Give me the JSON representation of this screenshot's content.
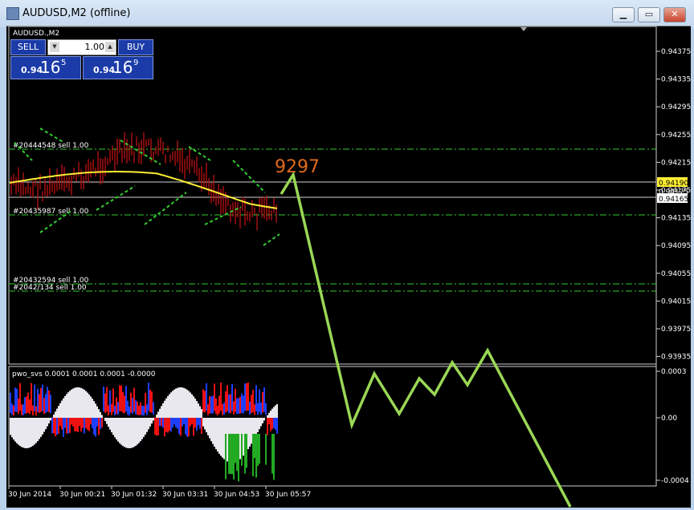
{
  "window": {
    "title": "AUDUSD,M2 (offline)",
    "min_label": "▁",
    "max_label": "▭",
    "close_label": "✕"
  },
  "chart": {
    "symbol_label": "AUDUSD.,M2"
  },
  "trade_panel": {
    "sell_label": "SELL",
    "buy_label": "BUY",
    "lot_size": "1.00",
    "bid_main": "0.94",
    "bid_big": "16",
    "bid_sup": "5",
    "ask_main": "0.94",
    "ask_big": "16",
    "ask_sup": "9"
  },
  "price_axis": {
    "ticks": [
      "0.94375",
      "0.94335",
      "0.94295",
      "0.94255",
      "0.94215",
      "0.94175",
      "0.94135",
      "0.94095",
      "0.94055",
      "0.94015",
      "0.93975",
      "0.93935"
    ],
    "current_price": "0.94190",
    "price_label_2": "0.94175",
    "price_label_3": "0.94165"
  },
  "orders": [
    {
      "label": "#20444548 sell 1.00"
    },
    {
      "label": "#20435987 sell 1.00"
    },
    {
      "label": "#20432594 sell 1.00"
    },
    {
      "label": "#2042/134 sell 1.00"
    }
  ],
  "annotation": {
    "text": "9297",
    "color": "#e06a1a"
  },
  "indicator": {
    "label": "pwo_svs 0.0001 0.0001 0.0001 -0.0000",
    "ticks": [
      "0.0003",
      "0.00",
      "-0.0004"
    ]
  },
  "time_axis": {
    "ticks": [
      "30 Jun 2014",
      "30 Jun 00:21",
      "30 Jun 01:32",
      "30 Jun 03:31",
      "30 Jun 04:53",
      "30 Jun 05:57"
    ]
  },
  "colors": {
    "grid_green": "#33cc33",
    "ma_yellow": "#ffee33",
    "candle_red": "#b01010",
    "overlay_green": "#9ad755"
  }
}
